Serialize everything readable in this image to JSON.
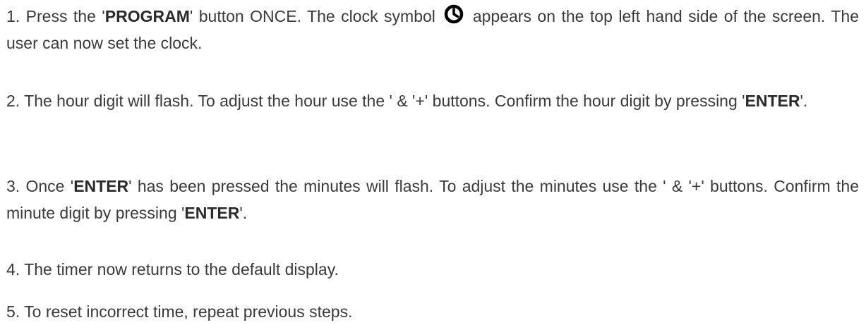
{
  "steps": [
    {
      "num": "1. ",
      "t1": "Press the '",
      "b1": "PROGRAM",
      "t2": "' button ONCE. The clock symbol ",
      "icon": "clock-icon",
      "t3": " appears on the top left hand side of the screen. The user can now set the clock."
    },
    {
      "num": "2. ",
      "t1": "The hour digit will flash. To adjust the hour use the ' & '+' buttons. Confirm the hour digit by pressing '",
      "b1": "ENTER",
      "t2": "'."
    },
    {
      "num": "3. ",
      "t1": "Once '",
      "b1": "ENTER",
      "t2": "' has been pressed the minutes will flash. To adjust the minutes use the ' & '+' buttons. Confirm the minute digit by pressing '",
      "b2": "ENTER",
      "t3": "'."
    },
    {
      "num": "4. ",
      "t1": "The timer now returns to the default display."
    },
    {
      "num": "5. ",
      "t1": "To reset incorrect time, repeat previous steps."
    }
  ]
}
